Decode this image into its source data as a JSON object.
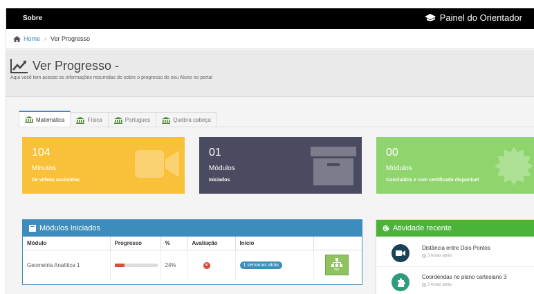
{
  "topbar": {
    "left_link": "Sobre",
    "right_title": "Painel do Orientador"
  },
  "breadcrumb": {
    "home": "Home",
    "current": "Ver Progresso"
  },
  "header": {
    "title": "Ver Progresso -",
    "subtitle": "Aqui você tem acesso as informações resumidas do sobre o progresso do seu Aluno no portal"
  },
  "tabs": [
    {
      "label": "Matemática",
      "active": true
    },
    {
      "label": "Física",
      "active": false
    },
    {
      "label": "Portugues",
      "active": false
    },
    {
      "label": "Quebra cabeça",
      "active": false
    }
  ],
  "stats": [
    {
      "number": "104",
      "label": "Minutos",
      "description": "De vídeos assistidos",
      "color": "#f9c13a",
      "icon": "video-camera-icon"
    },
    {
      "number": "01",
      "label": "Módulos",
      "description": "Iniciados",
      "color": "#4a4a60",
      "icon": "archive-box-icon"
    },
    {
      "number": "00",
      "label": "Módulos",
      "description": "Concluídos e com certificado disponível",
      "color": "#8fd46c",
      "icon": "certificate-icon"
    }
  ],
  "modules_panel": {
    "title": "Módulos Iniciados",
    "columns": [
      "Módulo",
      "Progresso",
      "%",
      "Avaliação",
      "Início",
      ""
    ],
    "rows": [
      {
        "module": "Geometria Analítica 1",
        "progress": 0.24,
        "percent": "24%",
        "evaluation_icon": "x-circle-icon",
        "start": "1 semanas atrás",
        "action": "Ver"
      }
    ]
  },
  "activity_panel": {
    "title": "Atividade recente",
    "items": [
      {
        "title": "Distância entre Dois Pontos",
        "time": "3 horas atrás",
        "icon": "video-camera-icon"
      },
      {
        "title": "Coordendas no plano cartesiano 3",
        "time": "3 horas atrás",
        "icon": "puzzle-icon"
      }
    ]
  },
  "colors": {
    "primary": "#3c8dbc",
    "success": "#4bb33a",
    "danger": "#dd4b39"
  }
}
